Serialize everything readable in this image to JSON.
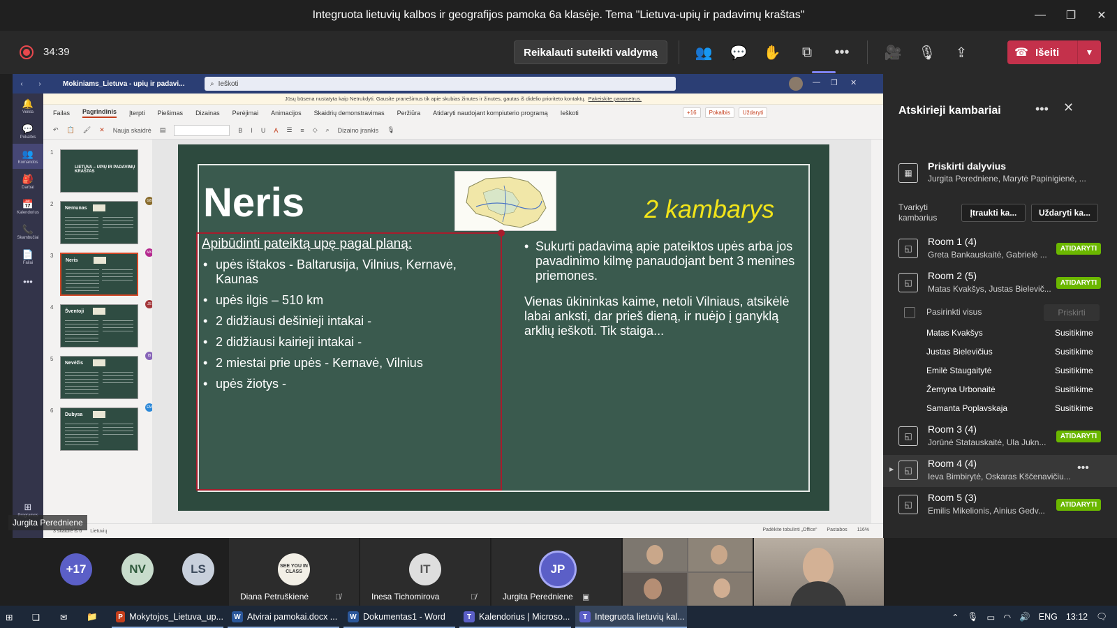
{
  "window": {
    "title": "Integruota lietuvių kalbos ir geografijos pamoka 6a klasėje. Tema \"Lietuva-upių ir padavimų kraštas\""
  },
  "toolbar": {
    "timer": "34:39",
    "request_control": "Reikalauti suteikti valdymą",
    "leave": "Išeiti"
  },
  "ppt": {
    "doc_name": "Mokiniams_Lietuva - upių ir padavi...",
    "search_placeholder": "Ieškoti",
    "notification": "Jūsų būsena nustatyta kaip Netrukdyti. Gausite pranešimus tik apie skubias žinutes ir žinutes, gautas iš didelio prioriteto kontaktų.",
    "notification_link": "Pakeiskite parametrus.",
    "tabs": [
      "Failas",
      "Pagrindinis",
      "Įterpti",
      "Piešimas",
      "Dizainas",
      "Perėjimai",
      "Animacijos",
      "Skaidrių demonstravimas",
      "Peržiūra",
      "Atidaryti naudojant kompiuterio programą",
      "Ieškoti"
    ],
    "ribbon_right": [
      "+16",
      "Pokalbis",
      "Uždaryti"
    ],
    "new_slide": "Nauja skaidrė",
    "design_tool": "Dizaino įrankis",
    "status_left": [
      "3 skaidrė iš 6",
      "Lietuvių"
    ],
    "status_right": [
      "Padėkite tobulinti „Office“",
      "Pastabos",
      "116%"
    ],
    "app_bar": [
      {
        "label": "Veikla",
        "icon": "🔔"
      },
      {
        "label": "Pokalbis",
        "icon": "💬"
      },
      {
        "label": "Komandos",
        "icon": "👥"
      },
      {
        "label": "Darbai",
        "icon": "🎒"
      },
      {
        "label": "Kalendorius",
        "icon": "📅"
      },
      {
        "label": "Skambučiai",
        "icon": "📞"
      },
      {
        "label": "Failai",
        "icon": "📄"
      }
    ],
    "app_bar_bottom": "Programos",
    "thumbnails": [
      {
        "num": "1",
        "title": "LIETUVA – UPIŲ IR PADAVIMŲ KRAŠTAS",
        "badge": ""
      },
      {
        "num": "2",
        "title": "Nemunas",
        "badge": "GB"
      },
      {
        "num": "3",
        "title": "Neris",
        "badge": "MK"
      },
      {
        "num": "4",
        "title": "Šventoji",
        "badge": "JS"
      },
      {
        "num": "5",
        "title": "Nevėžis",
        "badge": "IB"
      },
      {
        "num": "6",
        "title": "Dubysa",
        "badge": "EM"
      }
    ]
  },
  "slide": {
    "title": "Neris",
    "room_label": "2 kambarys",
    "heading": "Apibūdinti pateiktą upę pagal planą:",
    "items": [
      "upės ištakos -  Baltarusija, Vilnius, Kernavė, Kaunas",
      "upės ilgis – 510 km",
      "2 didžiausi dešinieji intakai -",
      "2 didžiausi kairieji intakai -",
      "2 miestai prie upės - Kernavė, Vilnius",
      "upės žiotys -"
    ],
    "task": "Sukurti padavimą apie pateiktos upės arba jos pavadinimo kilmę panaudojant bent 3 menines priemones.",
    "story": "Vienas ūkininkas kaime, netoli Vilniaus, atsikėlė labai anksti, dar prieš dieną, ir nuėjo į ganyklą arklių ieškoti. Tik staiga..."
  },
  "presenter_tag": "Jurgita Peredniene",
  "panel": {
    "title": "Atskirieji kambariai",
    "assign_title": "Priskirti dalyvius",
    "assign_names": "Jurgita Peredniene, Marytė Papinigienė, ...",
    "manage_label": "Tvarkyti kambarius",
    "add_room": "Įtraukti ka...",
    "close_rooms": "Uždaryti ka...",
    "open_label": "ATIDARYTI",
    "select_all": "Pasirinkti visus",
    "assign_btn": "Priskirti",
    "rooms": [
      {
        "name": "Room 1 (4)",
        "members": "Greta Bankauskaitė, Gabrielė ..."
      },
      {
        "name": "Room 2 (5)",
        "members": "Matas Kvakšys, Justas Bielevič..."
      },
      {
        "name": "Room 3 (4)",
        "members": "Jorūnė Statauskaitė, Ula Jukn..."
      },
      {
        "name": "Room 4 (4)",
        "members": "Ieva Bimbirytė, Oskaras Kščenavičiu..."
      },
      {
        "name": "Room 5 (3)",
        "members": "Emilis Mikelionis, Ainius Gedv..."
      }
    ],
    "room2_members": [
      {
        "name": "Matas Kvakšys",
        "status": "Susitikime"
      },
      {
        "name": "Justas Bielevičius",
        "status": "Susitikime"
      },
      {
        "name": "Emilė Staugaitytė",
        "status": "Susitikime"
      },
      {
        "name": "Žemyna Urbonaitė",
        "status": "Susitikime"
      },
      {
        "name": "Samanta Poplavskaja",
        "status": "Susitikime"
      }
    ]
  },
  "gallery": {
    "overflow": "+17",
    "avatars": [
      "NV",
      "LS"
    ],
    "tiles": [
      {
        "initials": "",
        "name": "Diana Petruškienė"
      },
      {
        "initials": "IT",
        "name": "Inesa Tichomirova"
      },
      {
        "initials": "JP",
        "name": "Jurgita Peredniene"
      }
    ]
  },
  "taskbar": {
    "apps": [
      {
        "label": "Mokytojos_Lietuva_up...",
        "icon": "P",
        "color": "#c43e1c"
      },
      {
        "label": "Atvirai pamokai.docx ...",
        "icon": "W",
        "color": "#2b579a"
      },
      {
        "label": "Dokumentas1 - Word",
        "icon": "W",
        "color": "#2b579a"
      },
      {
        "label": "Kalendorius | Microso...",
        "icon": "T",
        "color": "#5b5fc7"
      },
      {
        "label": "Integruota lietuvių kal...",
        "icon": "T",
        "color": "#5b5fc7"
      }
    ],
    "lang": "ENG",
    "time": "13:12"
  },
  "colors": {
    "accent": "#7f85f5",
    "leave": "#c4314b",
    "open_badge": "#6bb700",
    "slide_bg": "#3a5a4e",
    "room_label": "#f2e41a"
  }
}
